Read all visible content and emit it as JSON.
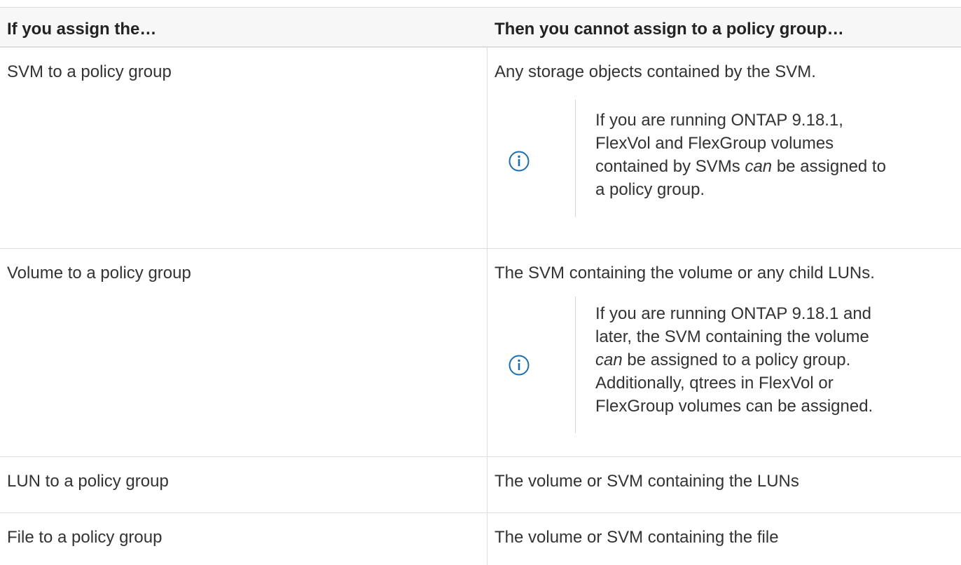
{
  "table": {
    "headers": [
      "If you assign the…",
      "Then you cannot assign to a policy group…"
    ],
    "rows": [
      {
        "assign": "SVM to a policy group",
        "cannot": "Any storage objects contained by the SVM.",
        "note": {
          "icon": "info-icon",
          "line1": "If you are running ONTAP 9.18.1,",
          "line2": "FlexVol and FlexGroup volumes",
          "line3_pre": "contained by SVMs ",
          "line3_em": "can",
          "line3_post": " be assigned to",
          "line4": "a policy group."
        }
      },
      {
        "assign": "Volume to a policy group",
        "cannot": "The SVM containing the volume or any child LUNs.",
        "note": {
          "icon": "info-icon",
          "line1": "If you are running ONTAP 9.18.1 and",
          "line2": "later, the SVM containing the volume",
          "line3_em": "can",
          "line3_post": " be assigned to a policy group.",
          "line4": "Additionally, qtrees in FlexVol or",
          "line5": "FlexGroup volumes can be assigned."
        }
      },
      {
        "assign": "LUN to a policy group",
        "cannot": "The volume or SVM containing the LUNs"
      },
      {
        "assign": "File to a policy group",
        "cannot": "The volume or SVM containing the file"
      }
    ]
  },
  "colors": {
    "info_icon": "#1a6fb0",
    "border": "#dddddd",
    "header_bg": "#f7f7f7"
  }
}
